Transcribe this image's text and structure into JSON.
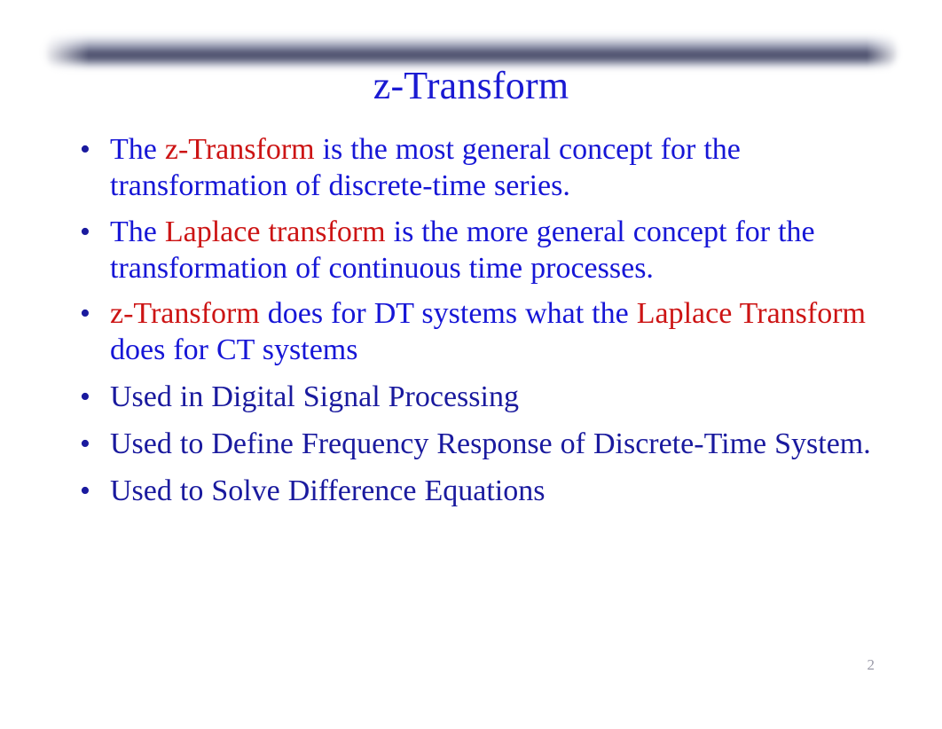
{
  "slide": {
    "title": "z-Transform",
    "page_number": "2",
    "bullet_marker": "•",
    "colors": {
      "title_blue": "#1a1ad2",
      "blue_bright": "#1616d6",
      "blue_navy": "#1a1a9e",
      "red": "#cc1414",
      "page_number_gray": "#9a9aa8",
      "deco_bar_dark": "#424564",
      "background": "#ffffff"
    },
    "decor": {
      "top_bar": "horizontal-gradient-bar"
    }
  },
  "bullets": [
    {
      "id": "bullet-1",
      "runs": [
        {
          "text": "The ",
          "color": "blue-bright"
        },
        {
          "text": "z-Transform",
          "color": "red"
        },
        {
          "text": " is the most general concept for the transformation of discrete-time series.",
          "color": "blue-bright"
        }
      ],
      "plain": "The z-Transform is the most general concept for the transformation of discrete-time series."
    },
    {
      "id": "bullet-2",
      "runs": [
        {
          "text": "The ",
          "color": "blue-bright"
        },
        {
          "text": "Laplace transform",
          "color": "red"
        },
        {
          "text": " is the more general concept for the transformation of continuous time processes.",
          "color": "blue-bright"
        }
      ],
      "plain": "The Laplace transform is the more general concept for the transformation of continuous time processes."
    },
    {
      "id": "bullet-3",
      "runs": [
        {
          "text": "z-Transform",
          "color": "red"
        },
        {
          "text": " does for DT systems what the ",
          "color": "blue-bright"
        },
        {
          "text": " Laplace Transform",
          "color": "red"
        },
        {
          "text": " does for CT systems",
          "color": "blue-bright"
        }
      ],
      "plain": "z-Transform does for DT systems what the Laplace Transform does for CT systems"
    },
    {
      "id": "bullet-4",
      "runs": [
        {
          "text": "Used in Digital Signal Processing",
          "color": "blue-navy"
        }
      ],
      "plain": "Used in Digital Signal Processing"
    },
    {
      "id": "bullet-5",
      "runs": [
        {
          "text": "Used to Define Frequency Response of Discrete-Time System.",
          "color": "blue-navy"
        }
      ],
      "plain": "Used to Define Frequency Response of Discrete-Time System."
    },
    {
      "id": "bullet-6",
      "runs": [
        {
          "text": "Used to Solve Difference Equations",
          "color": "blue-navy"
        }
      ],
      "plain": "Used to Solve Difference Equations"
    }
  ]
}
